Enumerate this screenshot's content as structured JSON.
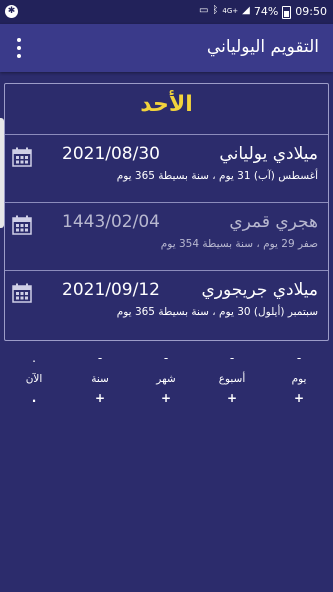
{
  "status_bar": {
    "signal": "4G+",
    "battery": "74%",
    "time": "09:50"
  },
  "app_bar": {
    "title": "التقويم اليولياني",
    "menu_icon": "overflow-menu-icon"
  },
  "day_name": "الأحد",
  "calendars": [
    {
      "name": "ميلادي يولياني",
      "date": "2021/08/30",
      "info": "أغسطس (آب) 31 يوم ، سنة بسيطة 365 يوم",
      "icon": "calendar-icon"
    },
    {
      "name": "هجري قمري",
      "date": "1443/02/04",
      "info": "صفر 29 يوم ، سنة بسيطة 354 يوم",
      "icon": "calendar-icon"
    },
    {
      "name": "ميلادي جريجوري",
      "date": "2021/09/12",
      "info": "سبتمبر (أيلول) 30 يوم ، سنة بسيطة 365 يوم",
      "icon": "calendar-icon"
    }
  ],
  "steppers": [
    {
      "label": "يوم",
      "minus": "-",
      "plus": "+"
    },
    {
      "label": "أسبوع",
      "minus": "-",
      "plus": "+"
    },
    {
      "label": "شهر",
      "minus": "-",
      "plus": "+"
    },
    {
      "label": "سنة",
      "minus": "-",
      "plus": "+"
    },
    {
      "label": "الآن",
      "minus": ".",
      "plus": "."
    }
  ],
  "colors": {
    "background": "#2c2c6c",
    "app_bar": "#3a3a8a",
    "day_text": "#f2d33c",
    "divider": "#8c8cbc"
  }
}
